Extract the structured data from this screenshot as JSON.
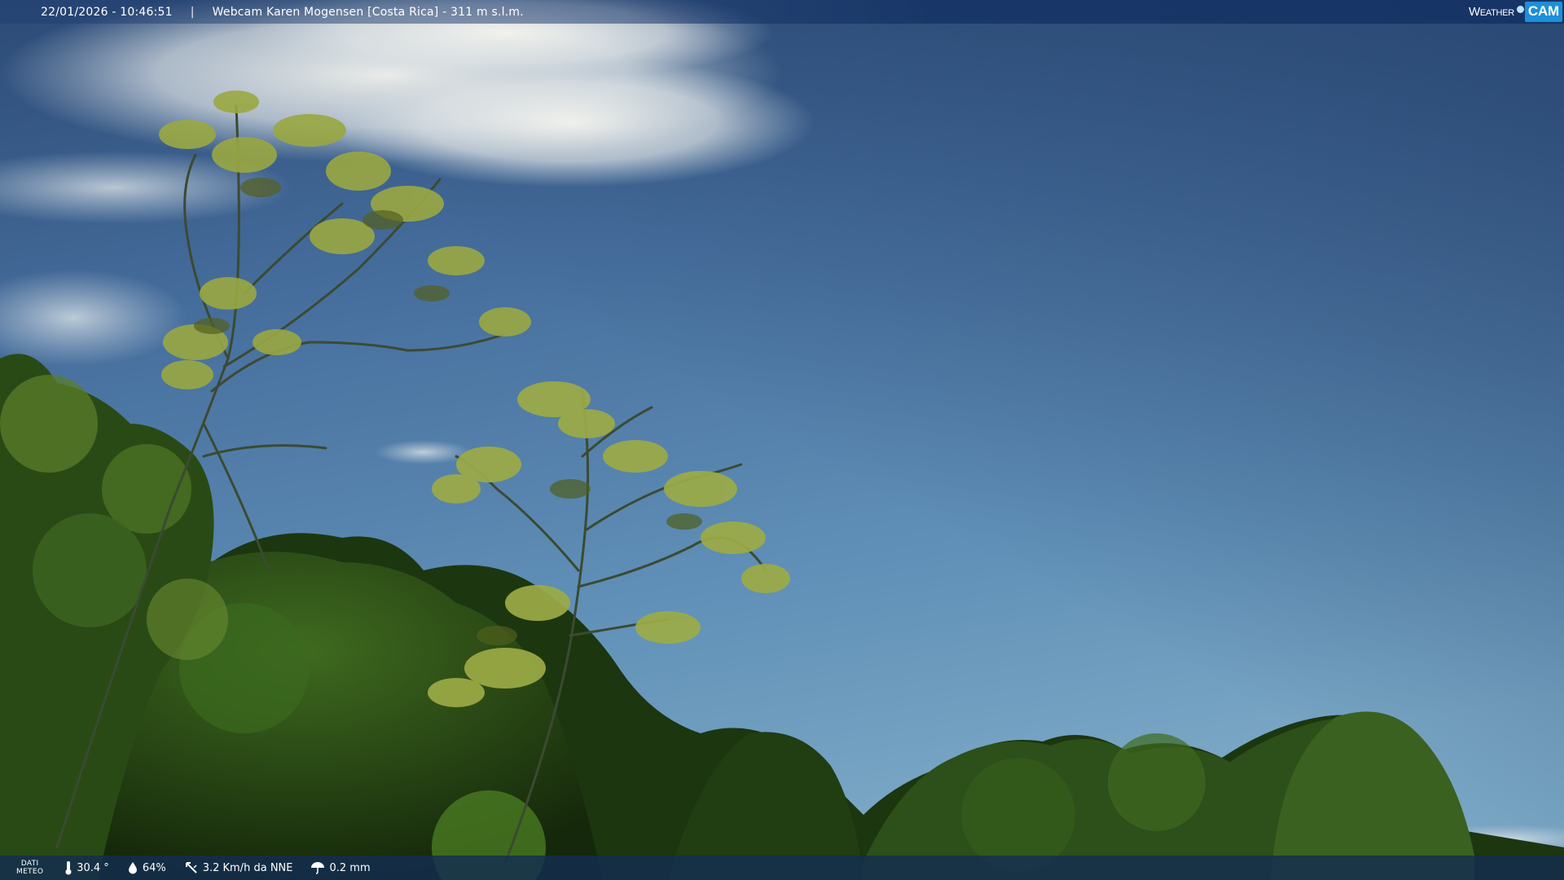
{
  "header": {
    "datetime": "22/01/2026 - 10:46:51",
    "separator": "|",
    "title": "Webcam Karen Mogensen [Costa Rica] - 311 m s.l.m."
  },
  "brand": {
    "weather": "Weather",
    "cam": "CAM"
  },
  "weather_bar": {
    "label_line1": "DATI",
    "label_line2": "METEO",
    "temperature": "30.4 °",
    "humidity": "64%",
    "wind": "3.2 Km/h da NNE",
    "rain": "0.2 mm"
  },
  "colors": {
    "sky_top": "#2f4f7a",
    "sky_bottom": "#6f9ec0",
    "foliage_dark": "#1f3a12",
    "foliage_light": "#9fb04a",
    "brand_accent": "#1e8fd8"
  }
}
